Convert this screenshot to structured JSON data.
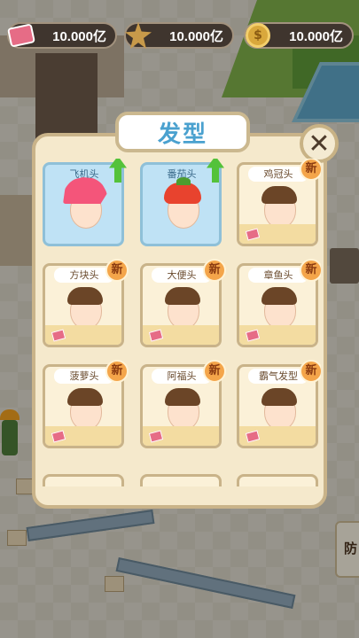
{
  "resources": [
    {
      "icon": "ticket-icon",
      "value": "10.000亿"
    },
    {
      "icon": "star-icon",
      "value": "10.000亿"
    },
    {
      "icon": "coin-icon",
      "value": "10.000亿"
    }
  ],
  "dialog": {
    "title": "发型",
    "close_label": "✕",
    "hairstyles": [
      {
        "name": "飞机头",
        "owned": true,
        "upgrade": true,
        "new": false,
        "hair": "pink"
      },
      {
        "name": "番茄头",
        "owned": true,
        "upgrade": true,
        "new": false,
        "hair": "tomato"
      },
      {
        "name": "鸡冠头",
        "owned": false,
        "upgrade": false,
        "new": true,
        "hair": "basic"
      },
      {
        "name": "方块头",
        "owned": false,
        "upgrade": false,
        "new": true,
        "hair": "basic"
      },
      {
        "name": "大便头",
        "owned": false,
        "upgrade": false,
        "new": true,
        "hair": "basic"
      },
      {
        "name": "章鱼头",
        "owned": false,
        "upgrade": false,
        "new": true,
        "hair": "basic"
      },
      {
        "name": "菠萝头",
        "owned": false,
        "upgrade": false,
        "new": true,
        "hair": "basic"
      },
      {
        "name": "阿福头",
        "owned": false,
        "upgrade": false,
        "new": true,
        "hair": "basic"
      },
      {
        "name": "霸气发型",
        "owned": false,
        "upgrade": false,
        "new": true,
        "hair": "basic"
      }
    ],
    "new_badge_label": "新"
  },
  "side_panel_label": "防",
  "colors": {
    "dialog_bg": "#f5e9cc",
    "owned_card": "#bfe2f5",
    "title_text": "#4aa1cf",
    "new_badge": "#f4a54a",
    "upgrade_arrow": "#54c23a"
  }
}
